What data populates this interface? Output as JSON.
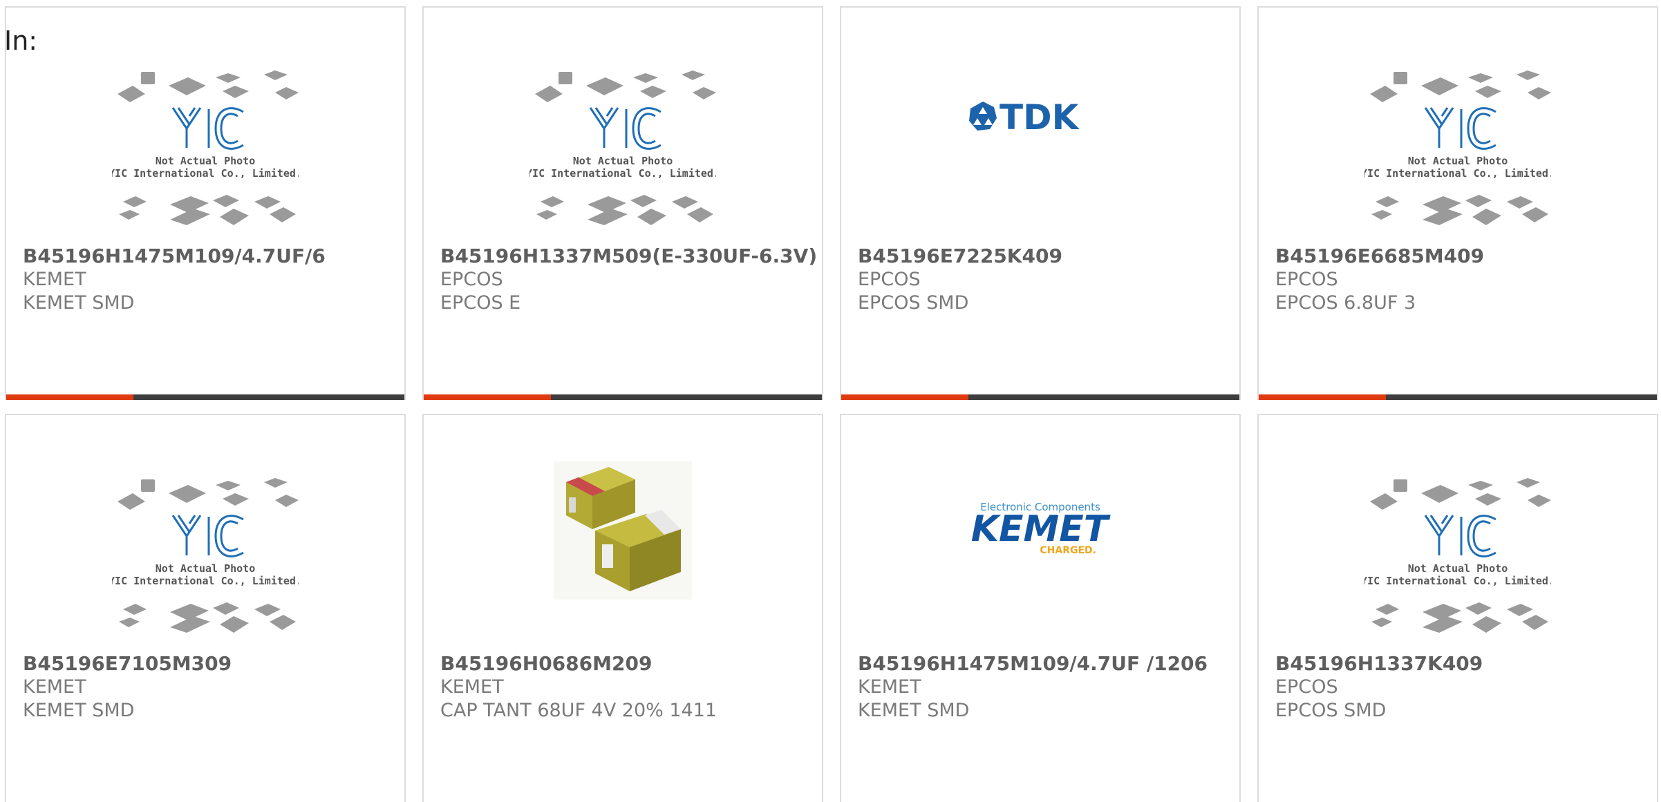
{
  "page": {
    "label": "In:"
  },
  "colors": {
    "accent_red": "#e03a10",
    "accent_dark": "#3d3d3d",
    "part_text": "#5e5e5e",
    "meta_text": "#7a7a7a",
    "card_border": "#dcdcdc"
  },
  "placeholder": {
    "line1": "Not Actual Photo",
    "line2": "YIC International Co., Limited.",
    "logo": "YIC"
  },
  "brand_logos": {
    "tdk": "TDK",
    "kemet_tagline": "Electronic Components",
    "kemet": "KEMET",
    "kemet_sub": "CHARGED."
  },
  "products": [
    {
      "part": "B45196H1475M109/4.7UF/6",
      "manufacturer": "KEMET",
      "description": "KEMET SMD",
      "image": "yic-placeholder-image",
      "has_accent": true
    },
    {
      "part": "B45196H1337M509(E-330UF-6.3V)",
      "manufacturer": "EPCOS",
      "description": "EPCOS E",
      "image": "yic-placeholder-image",
      "has_accent": true
    },
    {
      "part": "B45196E7225K409",
      "manufacturer": "EPCOS",
      "description": "EPCOS SMD",
      "image": "tdk-logo",
      "has_accent": true
    },
    {
      "part": "B45196E6685M409",
      "manufacturer": "EPCOS",
      "description": "EPCOS 6.8UF 3",
      "image": "yic-placeholder-image",
      "has_accent": true
    },
    {
      "part": "B45196E7105M309",
      "manufacturer": "KEMET",
      "description": "KEMET SMD",
      "image": "yic-placeholder-image",
      "has_accent": false
    },
    {
      "part": "B45196H0686M209",
      "manufacturer": "KEMET",
      "description": "CAP TANT 68UF 4V 20% 1411",
      "image": "tantalum-capacitor-photo",
      "has_accent": false
    },
    {
      "part": "B45196H1475M109/4.7UF /1206",
      "manufacturer": "KEMET",
      "description": "KEMET SMD",
      "image": "kemet-logo",
      "has_accent": false
    },
    {
      "part": "B45196H1337K409",
      "manufacturer": "EPCOS",
      "description": "EPCOS SMD",
      "image": "yic-placeholder-image",
      "has_accent": false
    }
  ]
}
